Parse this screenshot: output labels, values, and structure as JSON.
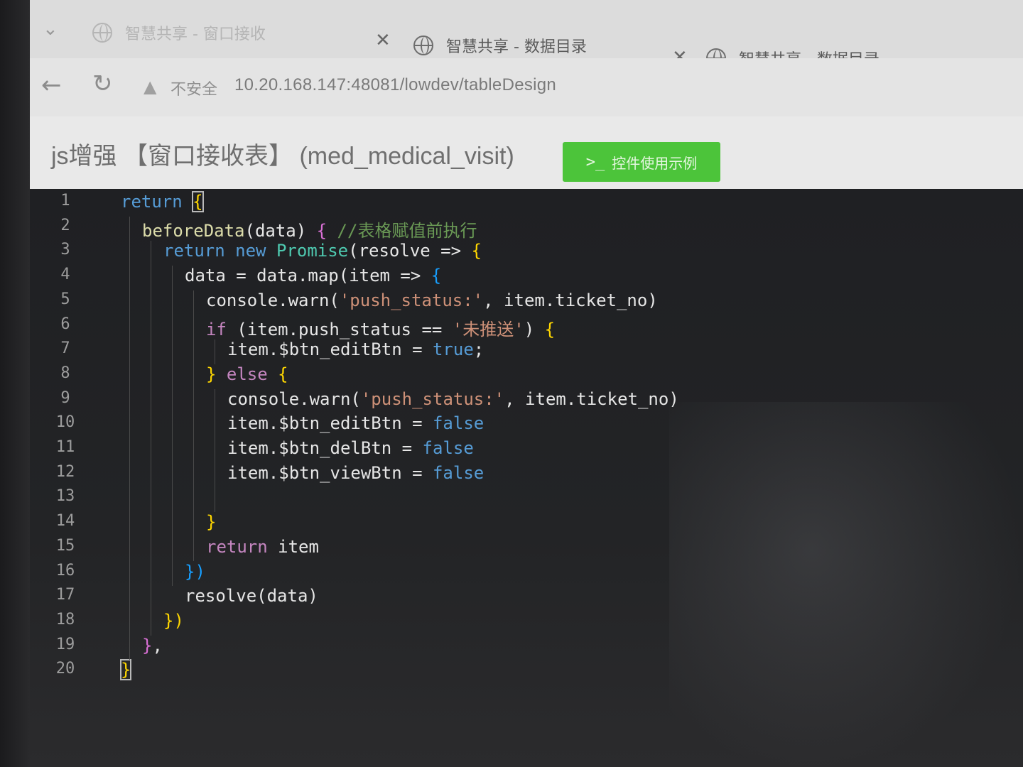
{
  "browser": {
    "tabs": [
      {
        "title": "智慧共享 - 窗口接收",
        "state": "inactive"
      },
      {
        "title": "智慧共享 - 数据目录",
        "state": "active"
      },
      {
        "title": "智慧共享 - 数据目录",
        "state": "active"
      }
    ],
    "insecure_label": "不安全",
    "url": "10.20.168.147:48081/lowdev/tableDesign"
  },
  "modal": {
    "title": "js增强 【窗口接收表】 (med_medical_visit)",
    "demo_button_label": "控件使用示例",
    "demo_button_icon": ">_"
  },
  "editor": {
    "line_numbers": [
      "1",
      "2",
      "3",
      "4",
      "5",
      "6",
      "7",
      "8",
      "9",
      "10",
      "11",
      "12",
      "13",
      "14",
      "15",
      "16",
      "17",
      "18",
      "19",
      "20"
    ],
    "lines": [
      {
        "tokens": [
          {
            "t": "return",
            "c": "kw"
          },
          {
            "t": " ",
            "c": "id"
          },
          {
            "t": "{",
            "c": "br1"
          }
        ]
      },
      {
        "tokens": [
          {
            "t": "beforeData",
            "c": "fn"
          },
          {
            "t": "(data) ",
            "c": "id"
          },
          {
            "t": "{",
            "c": "br2"
          },
          {
            "t": " //表格赋值前执行",
            "c": "cmt"
          }
        ]
      },
      {
        "tokens": [
          {
            "t": "return",
            "c": "kw"
          },
          {
            "t": " ",
            "c": "id"
          },
          {
            "t": "new",
            "c": "kw"
          },
          {
            "t": " ",
            "c": "id"
          },
          {
            "t": "Promise",
            "c": "cls"
          },
          {
            "t": "(resolve => ",
            "c": "id"
          },
          {
            "t": "{",
            "c": "br1"
          }
        ]
      },
      {
        "tokens": [
          {
            "t": "data = data.map(item => ",
            "c": "id"
          },
          {
            "t": "{",
            "c": "br3"
          }
        ]
      },
      {
        "tokens": [
          {
            "t": "console.warn(",
            "c": "id"
          },
          {
            "t": "'push_status:'",
            "c": "str"
          },
          {
            "t": ", item.ticket_no)",
            "c": "id"
          }
        ]
      },
      {
        "tokens": [
          {
            "t": "if",
            "c": "kw2"
          },
          {
            "t": " (item.push_status == ",
            "c": "id"
          },
          {
            "t": "'未推送'",
            "c": "str"
          },
          {
            "t": ") ",
            "c": "id"
          },
          {
            "t": "{",
            "c": "br1"
          }
        ]
      },
      {
        "tokens": [
          {
            "t": "item.$btn_editBtn = ",
            "c": "id"
          },
          {
            "t": "true",
            "c": "bool"
          },
          {
            "t": ";",
            "c": "id"
          }
        ]
      },
      {
        "tokens": [
          {
            "t": "}",
            "c": "br1"
          },
          {
            "t": " ",
            "c": "id"
          },
          {
            "t": "else",
            "c": "kw2"
          },
          {
            "t": " ",
            "c": "id"
          },
          {
            "t": "{",
            "c": "br1"
          }
        ]
      },
      {
        "tokens": [
          {
            "t": "console.warn(",
            "c": "id"
          },
          {
            "t": "'push_status:'",
            "c": "str"
          },
          {
            "t": ", item.ticket_no)",
            "c": "id"
          }
        ]
      },
      {
        "tokens": [
          {
            "t": "item.$btn_editBtn = ",
            "c": "id"
          },
          {
            "t": "false",
            "c": "bool"
          }
        ]
      },
      {
        "tokens": [
          {
            "t": "item.$btn_delBtn = ",
            "c": "id"
          },
          {
            "t": "false",
            "c": "bool"
          }
        ]
      },
      {
        "tokens": [
          {
            "t": "item.$btn_viewBtn = ",
            "c": "id"
          },
          {
            "t": "false",
            "c": "bool"
          }
        ]
      },
      {
        "tokens": []
      },
      {
        "tokens": [
          {
            "t": "}",
            "c": "br1"
          }
        ]
      },
      {
        "tokens": [
          {
            "t": "return",
            "c": "kw2"
          },
          {
            "t": " item",
            "c": "id"
          }
        ]
      },
      {
        "tokens": [
          {
            "t": "})",
            "c": "br3"
          }
        ]
      },
      {
        "tokens": [
          {
            "t": "resolve(data)",
            "c": "id"
          }
        ]
      },
      {
        "tokens": [
          {
            "t": "})",
            "c": "br1"
          }
        ]
      },
      {
        "tokens": [
          {
            "t": "}",
            "c": "br2"
          },
          {
            "t": ",",
            "c": "id"
          }
        ]
      },
      {
        "tokens": [
          {
            "t": "}",
            "c": "br1"
          }
        ]
      }
    ]
  }
}
